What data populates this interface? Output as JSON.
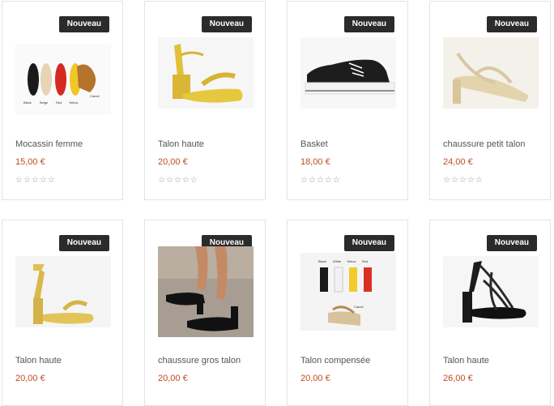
{
  "badge_label": "Nouveau",
  "products": [
    {
      "name": "Mocassin femme",
      "price": "15,00 €",
      "rating_stars": "☆☆☆☆☆",
      "image_labels": [
        "Black",
        "Beige",
        "Red",
        "Yellow",
        "Camel"
      ]
    },
    {
      "name": "Talon haute",
      "price": "20,00 €",
      "rating_stars": "☆☆☆☆☆"
    },
    {
      "name": "Basket",
      "price": "18,00 €",
      "rating_stars": "☆☆☆☆☆"
    },
    {
      "name": "chaussure petit talon",
      "price": "24,00 €",
      "rating_stars": "☆☆☆☆☆"
    },
    {
      "name": "Talon haute",
      "price": "20,00 €"
    },
    {
      "name": "chaussure gros talon",
      "price": "20,00 €"
    },
    {
      "name": "Talon compensée",
      "price": "20,00 €",
      "image_labels": [
        "Black",
        "White",
        "Yellow",
        "Red",
        "Camel"
      ]
    },
    {
      "name": "Talon haute",
      "price": "26,00 €"
    }
  ],
  "colors": {
    "badge_bg": "#2b2b2b",
    "price": "#c14a1f",
    "border": "#e3e3e3"
  }
}
